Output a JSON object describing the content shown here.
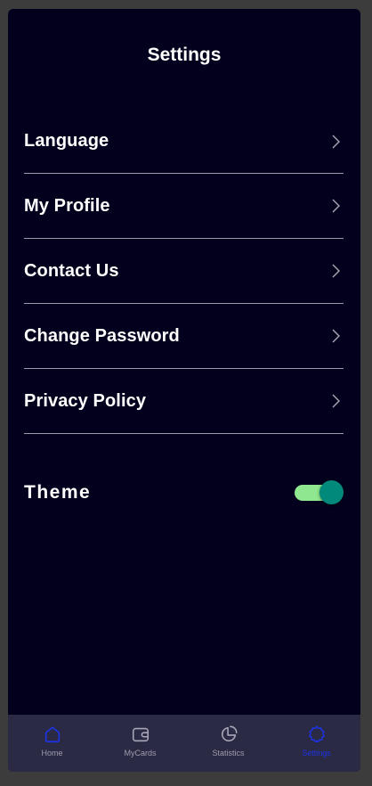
{
  "header": {
    "title": "Settings"
  },
  "menu": {
    "items": [
      {
        "label": "Language",
        "icon": "chevron-right-icon"
      },
      {
        "label": "My Profile",
        "icon": "chevron-right-icon"
      },
      {
        "label": "Contact Us",
        "icon": "chevron-right-icon"
      },
      {
        "label": "Change Password",
        "icon": "chevron-right-icon"
      },
      {
        "label": "Privacy Policy",
        "icon": "chevron-right-icon"
      }
    ]
  },
  "theme": {
    "label": "Theme",
    "toggle_on": true,
    "track_color": "#8fe88f",
    "thumb_color": "#01897b"
  },
  "bottom_nav": {
    "items": [
      {
        "label": "Home",
        "icon": "home-icon",
        "active": false
      },
      {
        "label": "MyCards",
        "icon": "wallet-icon",
        "active": false
      },
      {
        "label": "Statistics",
        "icon": "pie-chart-icon",
        "active": false
      },
      {
        "label": "Settings",
        "icon": "gear-icon",
        "active": true
      }
    ],
    "active_color": "#1c33e6",
    "inactive_color": "#9d9cae"
  },
  "colors": {
    "background": "#02001c",
    "nav_background": "#2b2a44",
    "divider": "#9a9aa8"
  }
}
